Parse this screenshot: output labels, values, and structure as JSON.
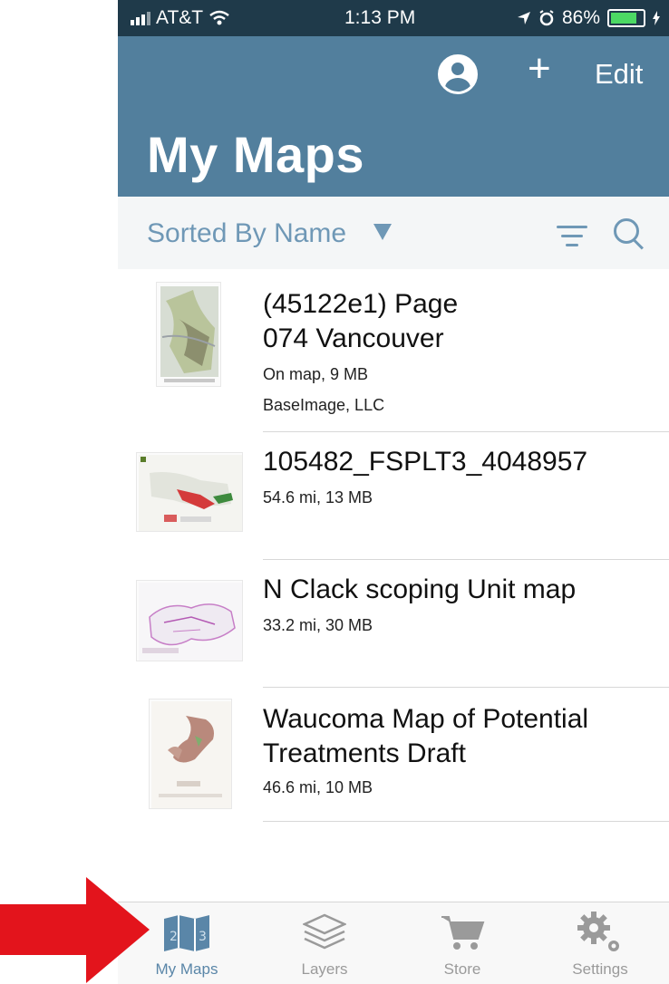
{
  "status_bar": {
    "carrier": "AT&T",
    "time": "1:13 PM",
    "battery": "86%",
    "icons": [
      "signal-icon",
      "wifi-icon",
      "location-icon",
      "alarm-icon",
      "battery-icon",
      "charging-icon"
    ]
  },
  "nav": {
    "title": "My Maps",
    "edit_label": "Edit",
    "add_label": "+",
    "color": "#527f9d"
  },
  "sort_bar": {
    "label": "Sorted By Name",
    "accent": "#6f98b6"
  },
  "maps": [
    {
      "title_lines": [
        "(45122e1) Page",
        "074 Vancouver"
      ],
      "details": [
        "On map, 9 MB",
        "BaseImage, LLC"
      ]
    },
    {
      "title_lines": [
        "105482_FSPLT3_4048957"
      ],
      "details": [
        "54.6 mi, 13 MB"
      ]
    },
    {
      "title_lines": [
        "N Clack scoping Unit map"
      ],
      "details": [
        "33.2 mi, 30 MB"
      ]
    },
    {
      "title_lines": [
        "Waucoma Map of Potential",
        "Treatments Draft"
      ],
      "details": [
        "46.6 mi, 10 MB"
      ]
    }
  ],
  "tabs": [
    {
      "label": "My Maps",
      "icon": "map-icon",
      "active": true
    },
    {
      "label": "Layers",
      "icon": "layers-icon",
      "active": false
    },
    {
      "label": "Store",
      "icon": "cart-icon",
      "active": false
    },
    {
      "label": "Settings",
      "icon": "gear-icon",
      "active": false
    }
  ],
  "annotation": {
    "icon": "red-arrow-icon",
    "color": "#e3141c"
  }
}
